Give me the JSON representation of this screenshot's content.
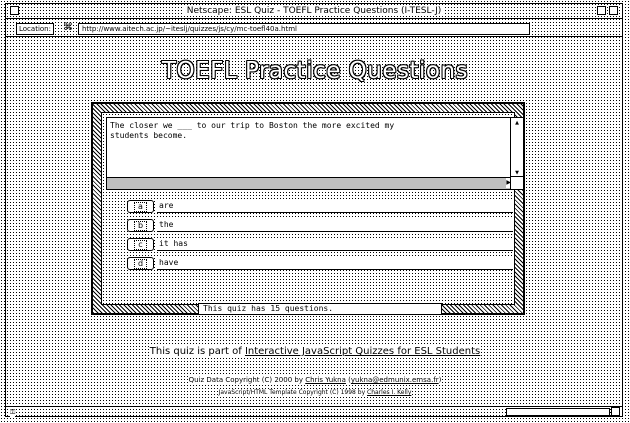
{
  "window": {
    "title": "Netscape: ESL Quiz - TOEFL Practice Questions (I-TESL-J)"
  },
  "location_bar": {
    "label": "Location:",
    "url": "http://www.aitech.ac.jp/~iteslj/quizzes/js/cy/mc-toefl40a.html"
  },
  "page": {
    "title": "TOEFL Practice Questions"
  },
  "quiz": {
    "question": "The closer we ___ to our trip to Boston the more excited my\nstudents become.",
    "answers": [
      {
        "letter": "a",
        "text": "are"
      },
      {
        "letter": "b",
        "text": "the"
      },
      {
        "letter": "c",
        "text": "it has"
      },
      {
        "letter": "d",
        "text": "have"
      }
    ],
    "status": "This quiz has 15 questions."
  },
  "footer": {
    "part_prefix": "This quiz is part of ",
    "part_link": "Interactive JavaScript Quizzes for ESL Students",
    "copyright1_prefix": "Quiz Data Copyright (C) 2000 by ",
    "copyright1_name": "Chris Yukna",
    "copyright1_open": " (",
    "copyright1_email": "yukna@edmunix.emsa.fr",
    "copyright1_close": ")",
    "copyright2_prefix": "JavaScript/HTML Template Copyright (C) 1998 by ",
    "copyright2_name": "Charles I. Kelly"
  }
}
